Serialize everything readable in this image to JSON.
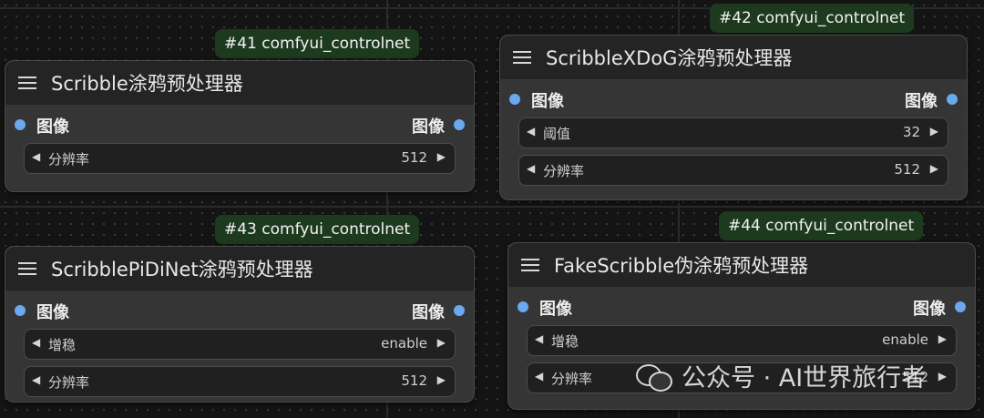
{
  "nodes": [
    {
      "badge": {
        "text": "#41 comfyui_controlnet",
        "num": "#41"
      },
      "title": "Scribble涂鸦预处理器",
      "input_label": "图像",
      "output_label": "图像",
      "widgets": [
        {
          "label": "分辨率",
          "value": "512"
        }
      ]
    },
    {
      "badge": {
        "text": "#42 comfyui_controlnet",
        "num": "#42"
      },
      "title": "ScribbleXDoG涂鸦预处理器",
      "input_label": "图像",
      "output_label": "图像",
      "widgets": [
        {
          "label": "阈值",
          "value": "32"
        },
        {
          "label": "分辨率",
          "value": "512"
        }
      ]
    },
    {
      "badge": {
        "text": "#43 comfyui_controlnet",
        "num": "#43"
      },
      "title": "ScribblePiDiNet涂鸦预处理器",
      "input_label": "图像",
      "output_label": "图像",
      "widgets": [
        {
          "label": "增稳",
          "value": "enable"
        },
        {
          "label": "分辨率",
          "value": "512"
        }
      ]
    },
    {
      "badge": {
        "text": "#44 comfyui_controlnet",
        "num": "#44"
      },
      "title": "FakeScribble伪涂鸦预处理器",
      "input_label": "图像",
      "output_label": "图像",
      "widgets": [
        {
          "label": "增稳",
          "value": "enable"
        },
        {
          "label": "分辨率",
          "value": "512"
        }
      ]
    }
  ],
  "watermark": {
    "text": "公众号 · AI世界旅行者",
    "icon": "wechat-icon"
  },
  "colors": {
    "badge_bg": "#1d3a1f",
    "slot_dot": "#6aa8f0",
    "node_bg": "#353535",
    "header_bg": "#242424"
  }
}
